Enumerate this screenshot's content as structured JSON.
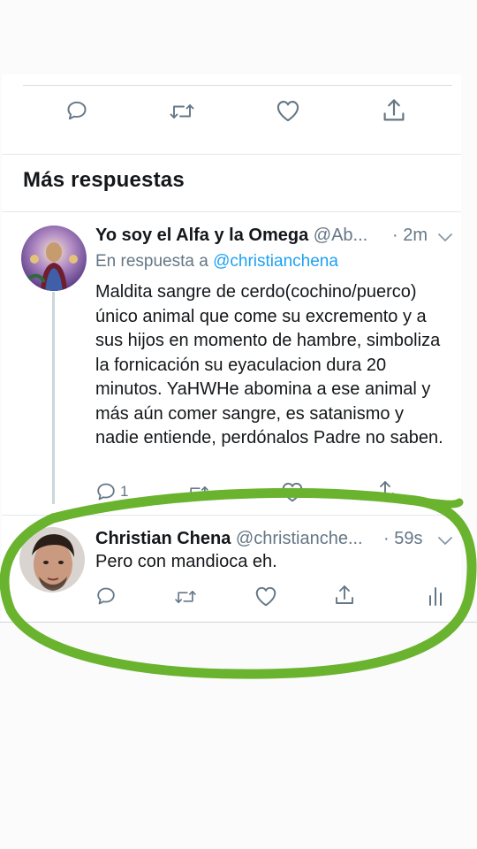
{
  "section_title": "Más respuestas",
  "colors": {
    "accent": "#1da1f2",
    "secondary_text": "#657786",
    "annotation_green": "#69b32f"
  },
  "reply1": {
    "name": "Yo soy el Alfa y la Omega",
    "handle": "@Ab...",
    "time": "· 2m",
    "replying_prefix": "En respuesta a",
    "replying_to": "@christianchena",
    "text": "Maldita sangre de cerdo(cochino/puerco) único animal que come su excremento y a sus hijos en momento de hambre, simboliza la fornicación su eyaculacion dura 20 minutos. YaHWHe abomina a ese animal y más aún comer sangre, es satanismo y nadie entiende, perdónalos Padre no saben.",
    "reply_count": "1"
  },
  "reply2": {
    "name": "Christian Chena",
    "handle": "@christianche...",
    "time": "· 59s",
    "text": "Pero con mandioca eh."
  },
  "icons": {
    "reply": "reply-bubble-icon",
    "retweet": "retweet-icon",
    "like": "heart-icon",
    "share": "share-icon",
    "analytics": "analytics-bars-icon",
    "more": "chevron-down-icon"
  }
}
